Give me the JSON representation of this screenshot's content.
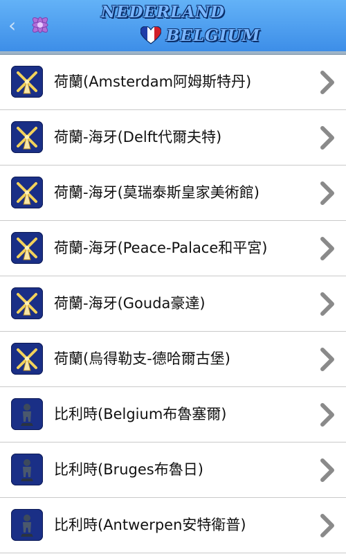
{
  "header": {
    "title_line1": "NEDERLAND",
    "title_line2": "BELGIUM",
    "back_glyph": "‹",
    "icons": {
      "back": "back-chevron-icon",
      "logo": "lavender-flower-icon",
      "heart": "flag-heart-icon"
    }
  },
  "items": [
    {
      "label": "荷蘭(Amsterdam阿姆斯特丹)",
      "icon": "windmill-icon"
    },
    {
      "label": "荷蘭-海牙(Delft代爾夫特)",
      "icon": "windmill-icon"
    },
    {
      "label": "荷蘭-海牙(莫瑞泰斯皇家美術館)",
      "icon": "windmill-icon"
    },
    {
      "label": "荷蘭-海牙(Peace-Palace和平宮)",
      "icon": "windmill-icon"
    },
    {
      "label": "荷蘭-海牙(Gouda豪達)",
      "icon": "windmill-icon"
    },
    {
      "label": "荷蘭(烏得勒支-德哈爾古堡)",
      "icon": "windmill-icon"
    },
    {
      "label": "比利時(Belgium布魯塞爾)",
      "icon": "manneken-pis-icon"
    },
    {
      "label": "比利時(Bruges布魯日)",
      "icon": "manneken-pis-icon"
    },
    {
      "label": "比利時(Antwerpen安特衛普)",
      "icon": "manneken-pis-icon"
    }
  ],
  "colors": {
    "header_top": "#63b2f7",
    "header_bottom": "#3d8ee8",
    "icon_bg": "#1a2f86",
    "chevron": "#8a8a8a"
  }
}
